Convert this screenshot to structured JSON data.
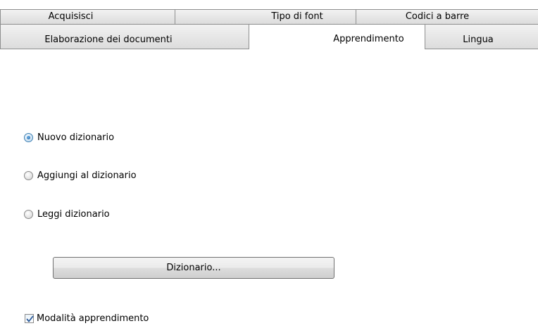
{
  "tabs": {
    "row1": [
      {
        "label": "Acquisisci"
      },
      {
        "label": "Tipo di font"
      },
      {
        "label": "Codici a barre"
      }
    ],
    "row2": [
      {
        "label": "Elaborazione dei documenti"
      },
      {
        "label": "Apprendimento",
        "active": true
      },
      {
        "label": "Lingua"
      }
    ]
  },
  "options": [
    {
      "label": "Nuovo dizionario",
      "checked": true
    },
    {
      "label": "Aggiungi al dizionario",
      "checked": false
    },
    {
      "label": "Leggi dizionario",
      "checked": false
    }
  ],
  "dictionary_button": {
    "label": "Dizionario..."
  },
  "learning_mode": {
    "label": "Modalità apprendimento",
    "checked": true
  },
  "colors": {
    "radio_selected": "#1b5e9e",
    "checkmark": "#2a5a9a"
  }
}
